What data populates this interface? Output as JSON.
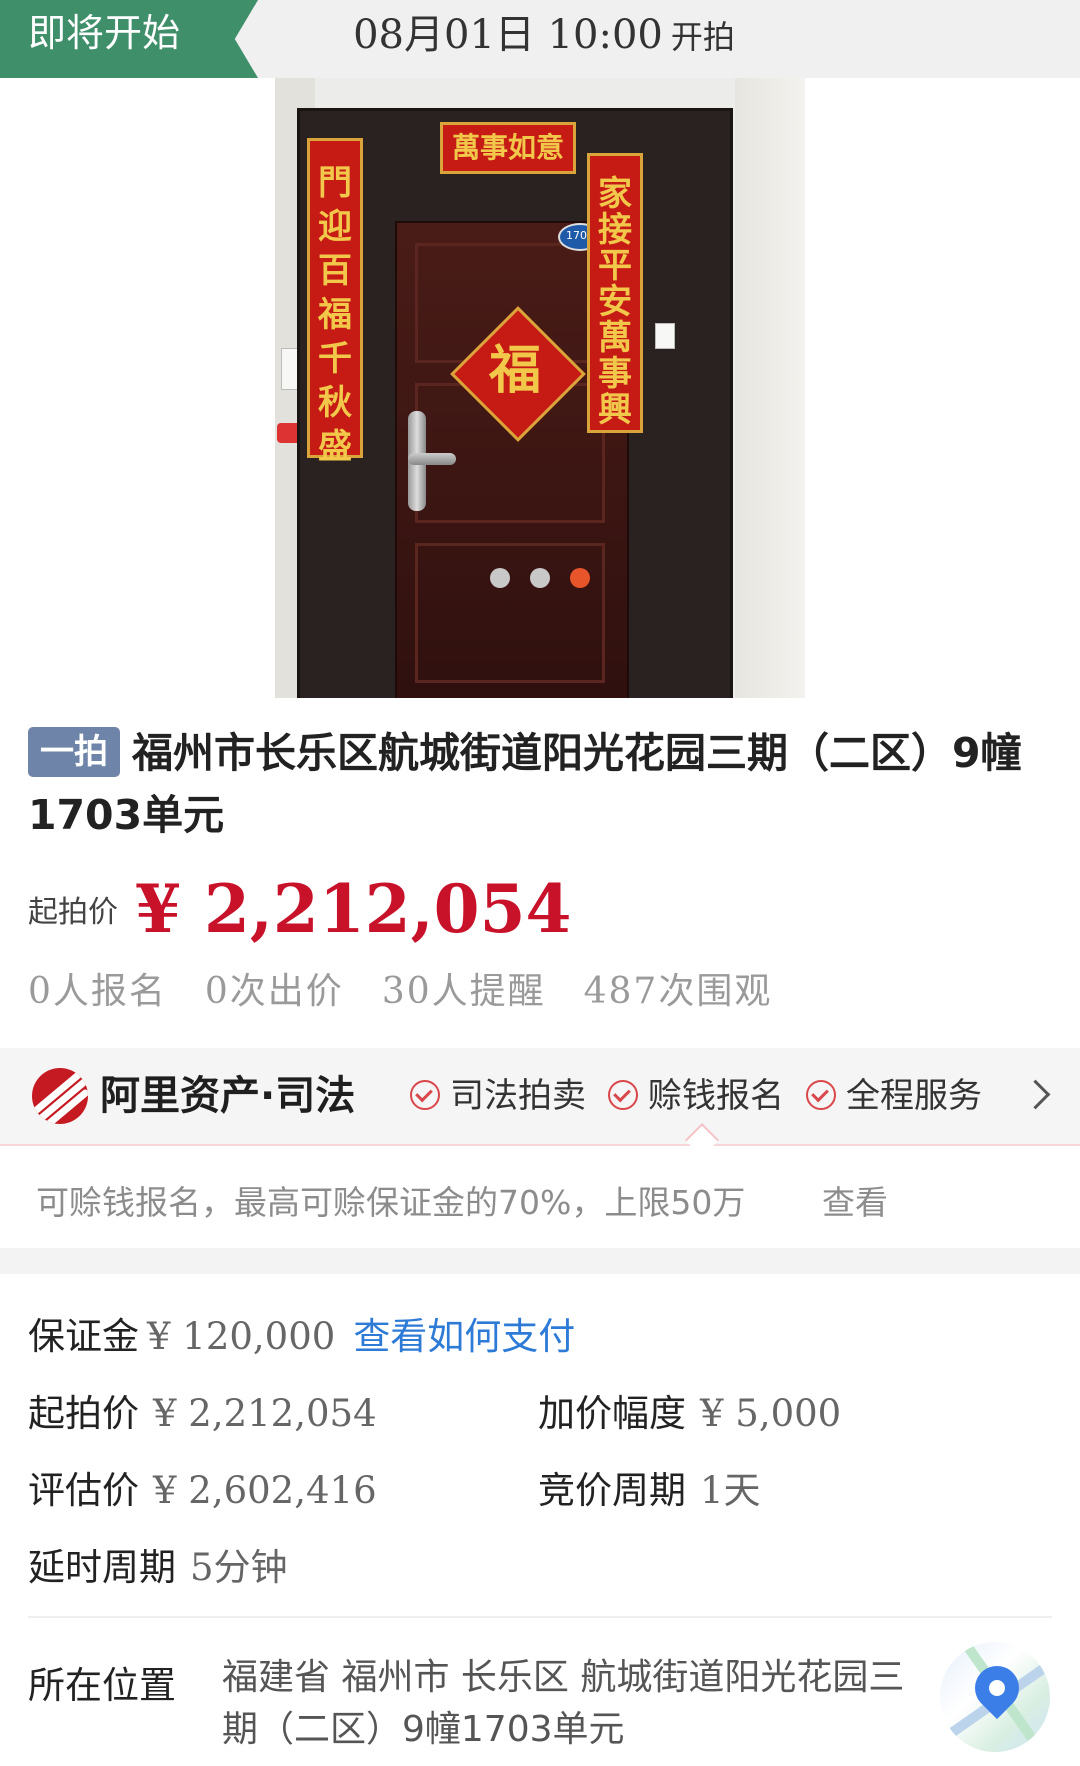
{
  "banner": {
    "status": "即将开始",
    "time": "08月01日 10:00",
    "time_suffix": "开拍"
  },
  "photo": {
    "hengpi": "萬事如意",
    "couplet_left": "門迎百福千秋盛",
    "couplet_right": "家接平安萬事興",
    "fu": "福",
    "door_number": "1703",
    "carousel_total": 3,
    "carousel_active": 3
  },
  "title": {
    "badge": "一拍",
    "text": "福州市长乐区航城街道阳光花园三期（二区）9幢1703单元"
  },
  "price": {
    "label": "起拍价",
    "value": "¥ 2,212,054"
  },
  "stats": {
    "signups": "0人报名",
    "bids": "0次出价",
    "reminders": "30人提醒",
    "views": "487次围观"
  },
  "service": {
    "brand": "阿里资产·司法",
    "items": [
      "司法拍卖",
      "赊钱报名",
      "全程服务"
    ],
    "info_text": "可赊钱报名，最高可赊保证金的70%，上限50万",
    "info_link": "查看"
  },
  "details": {
    "deposit_label": "保证金",
    "deposit_value": "¥ 120,000",
    "deposit_link": "查看如何支付",
    "start_price_label": "起拍价",
    "start_price_value": "¥ 2,212,054",
    "increment_label": "加价幅度",
    "increment_value": "¥ 5,000",
    "appraisal_label": "评估价",
    "appraisal_value": "¥ 2,602,416",
    "cycle_label": "竞价周期",
    "cycle_value": "1天",
    "extension_label": "延时周期",
    "extension_value": "5分钟"
  },
  "location": {
    "label": "所在位置",
    "value": "福建省 福州市 长乐区 航城街道阳光花园三期（二区）9幢1703单元"
  },
  "colors": {
    "status_green": "#3f8f6b",
    "price_red": "#c8122a",
    "link_blue": "#2d7bd6",
    "badge_blue": "#6e84a8",
    "carousel_active": "#e8552a"
  }
}
